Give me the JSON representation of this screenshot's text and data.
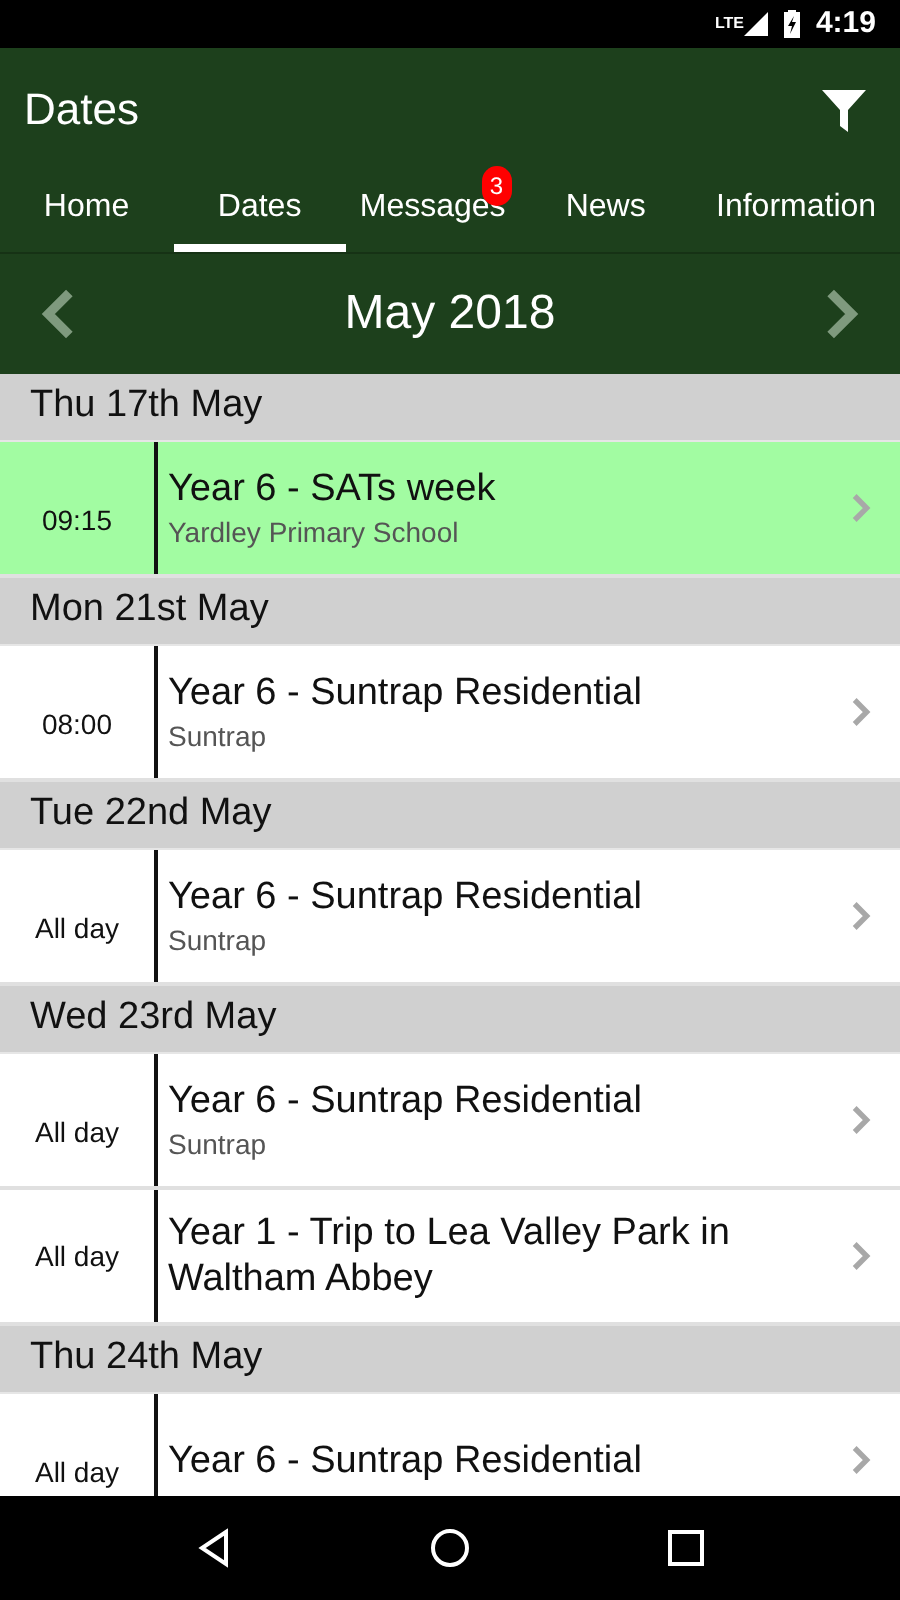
{
  "status_bar": {
    "network": "LTE",
    "time": "4:19"
  },
  "app_bar": {
    "title": "Dates"
  },
  "tabs": [
    {
      "label": "Home",
      "selected": false
    },
    {
      "label": "Dates",
      "selected": true
    },
    {
      "label": "Messages",
      "selected": false,
      "badge": "3"
    },
    {
      "label": "News",
      "selected": false
    },
    {
      "label": "Information",
      "selected": false
    }
  ],
  "month_nav": {
    "title": "May 2018"
  },
  "days": [
    {
      "date": "Thu 17th May",
      "events": [
        {
          "time": "09:15",
          "title": "Year 6 - SATs week",
          "location": "Yardley Primary School",
          "highlighted": true
        }
      ]
    },
    {
      "date": "Mon 21st May",
      "events": [
        {
          "time": "08:00",
          "title": "Year 6 - Suntrap Residential",
          "location": "Suntrap",
          "highlighted": false
        }
      ]
    },
    {
      "date": "Tue 22nd May",
      "events": [
        {
          "time": "All day",
          "title": "Year 6 - Suntrap Residential",
          "location": "Suntrap",
          "highlighted": false
        }
      ]
    },
    {
      "date": "Wed 23rd May",
      "events": [
        {
          "time": "All day",
          "title": "Year 6 - Suntrap Residential",
          "location": "Suntrap",
          "highlighted": false
        },
        {
          "time": "All day",
          "title": "Year 1 - Trip to Lea Valley Park in Waltham Abbey",
          "highlighted": false
        }
      ]
    },
    {
      "date": "Thu 24th May",
      "events": [
        {
          "time": "All day",
          "title": "Year 6 - Suntrap Residential",
          "highlighted": false
        }
      ]
    }
  ]
}
